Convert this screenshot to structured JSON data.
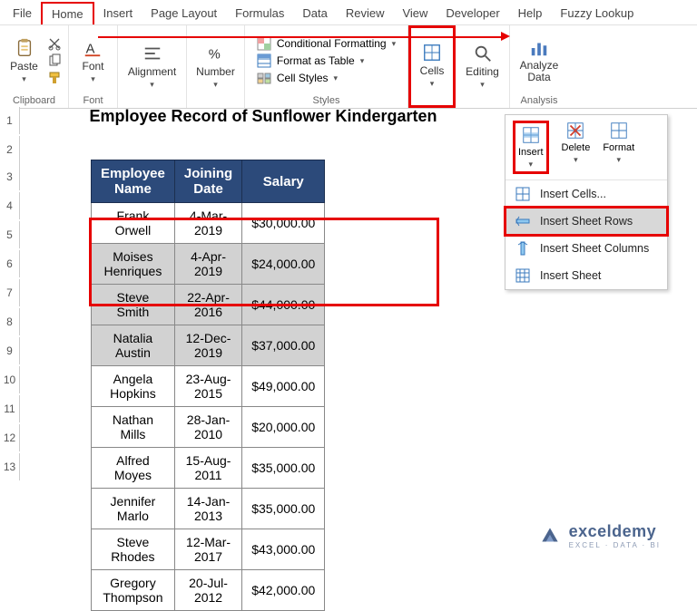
{
  "tabs": [
    "File",
    "Home",
    "Insert",
    "Page Layout",
    "Formulas",
    "Data",
    "Review",
    "View",
    "Developer",
    "Help",
    "Fuzzy Lookup"
  ],
  "active_tab": "Home",
  "ribbon": {
    "clipboard": {
      "label": "Clipboard",
      "paste": "Paste"
    },
    "font": {
      "label": "Font",
      "btn": "Font"
    },
    "alignment": {
      "label": "",
      "btn": "Alignment"
    },
    "number": {
      "label": "",
      "btn": "Number"
    },
    "styles": {
      "label": "Styles",
      "cond_fmt": "Conditional Formatting",
      "fmt_table": "Format as Table",
      "cell_styles": "Cell Styles"
    },
    "cells": {
      "label": "",
      "btn": "Cells"
    },
    "editing": {
      "label": "",
      "btn": "Editing"
    },
    "analysis": {
      "label": "Analysis",
      "btn": "Analyze Data"
    }
  },
  "cells_panel": {
    "insert": "Insert",
    "delete": "Delete",
    "format": "Format",
    "items": {
      "insert_cells": "Insert Cells...",
      "insert_rows": "Insert Sheet Rows",
      "insert_cols": "Insert Sheet Columns",
      "insert_sheet": "Insert Sheet"
    }
  },
  "sheet": {
    "title": "Employee Record of Sunflower Kindergarten",
    "headers": {
      "name": "Employee Name",
      "date": "Joining Date",
      "salary": "Salary"
    },
    "rows": [
      {
        "name": "Frank Orwell",
        "date": "4-Mar-2019",
        "salary": "$30,000.00",
        "sel": false
      },
      {
        "name": "Moises Henriques",
        "date": "4-Apr-2019",
        "salary": "$24,000.00",
        "sel": true
      },
      {
        "name": "Steve Smith",
        "date": "22-Apr-2016",
        "salary": "$44,000.00",
        "sel": true
      },
      {
        "name": "Natalia Austin",
        "date": "12-Dec-2019",
        "salary": "$37,000.00",
        "sel": true
      },
      {
        "name": "Angela Hopkins",
        "date": "23-Aug-2015",
        "salary": "$49,000.00",
        "sel": false
      },
      {
        "name": "Nathan Mills",
        "date": "28-Jan-2010",
        "salary": "$20,000.00",
        "sel": false
      },
      {
        "name": "Alfred Moyes",
        "date": "15-Aug-2011",
        "salary": "$35,000.00",
        "sel": false
      },
      {
        "name": "Jennifer Marlo",
        "date": "14-Jan-2013",
        "salary": "$35,000.00",
        "sel": false
      },
      {
        "name": "Steve Rhodes",
        "date": "12-Mar-2017",
        "salary": "$43,000.00",
        "sel": false
      },
      {
        "name": "Gregory Thompson",
        "date": "20-Jul-2012",
        "salary": "$42,000.00",
        "sel": false
      }
    ],
    "row_numbers": [
      1,
      2,
      3,
      4,
      5,
      6,
      7,
      8,
      9,
      10,
      11,
      12,
      13
    ]
  },
  "watermark": {
    "brand": "exceldemy",
    "sub": "EXCEL · DATA · BI"
  }
}
